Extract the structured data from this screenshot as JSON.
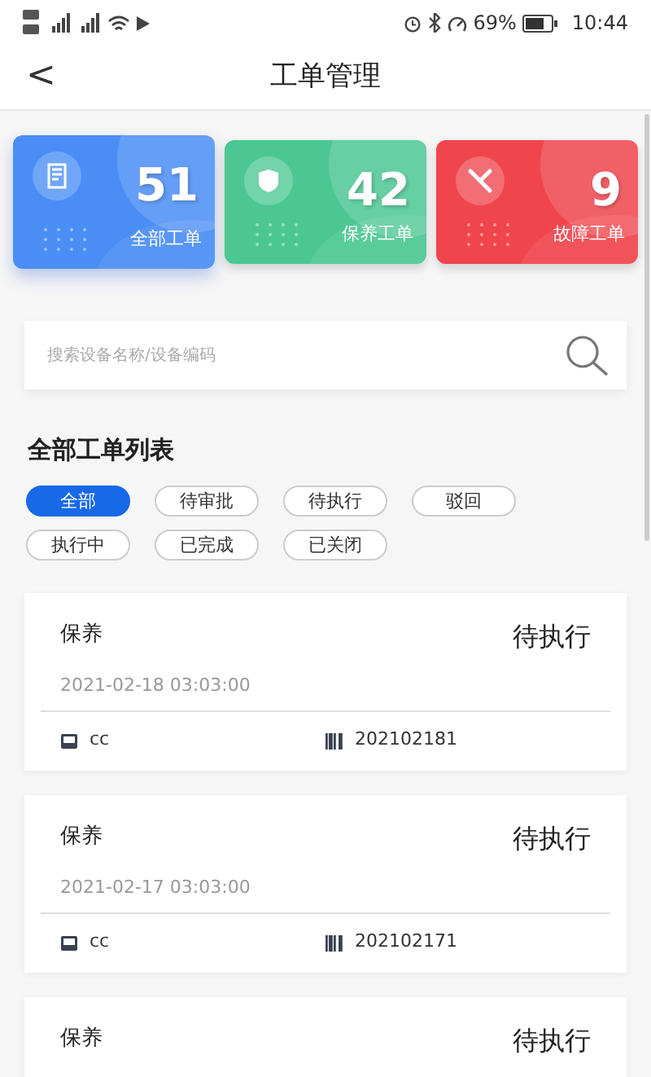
{
  "status_bar": {
    "battery": "69%",
    "time": "10:44"
  },
  "header": {
    "back": "<",
    "title": "工单管理"
  },
  "stats": [
    {
      "kind": "all",
      "count": "51",
      "label": "全部工单",
      "color": "#4a8ef5",
      "selected": true
    },
    {
      "kind": "maintain",
      "count": "42",
      "label": "保养工单",
      "color": "#4cc793",
      "selected": false
    },
    {
      "kind": "fault",
      "count": "9",
      "label": "故障工单",
      "color": "#f0454d",
      "selected": false
    }
  ],
  "search": {
    "placeholder": "搜索设备名称/设备编码"
  },
  "list_title": "全部工单列表",
  "filters": [
    {
      "label": "全部",
      "selected": true
    },
    {
      "label": "待审批",
      "selected": false
    },
    {
      "label": "待执行",
      "selected": false
    },
    {
      "label": "驳回",
      "selected": false
    },
    {
      "label": "执行中",
      "selected": false
    },
    {
      "label": "已完成",
      "selected": false
    },
    {
      "label": "已关闭",
      "selected": false
    }
  ],
  "orders": [
    {
      "type": "保养",
      "status": "待执行",
      "time": "2021-02-18 03:03:00",
      "device": "cc",
      "code": "202102181"
    },
    {
      "type": "保养",
      "status": "待执行",
      "time": "2021-02-17 03:03:00",
      "device": "cc",
      "code": "202102171"
    },
    {
      "type": "保养",
      "status": "待执行"
    }
  ]
}
